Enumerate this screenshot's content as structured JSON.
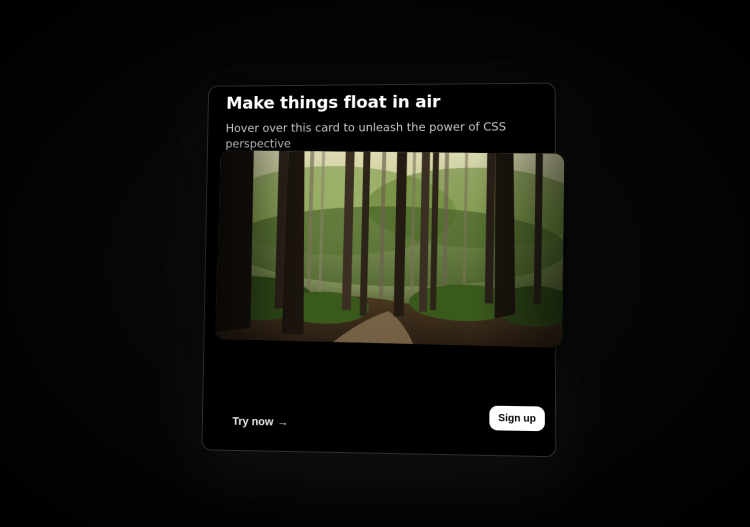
{
  "card": {
    "title": "Make things float in air",
    "subtitle": "Hover over this card to unleash the power of CSS perspective",
    "image_subject": "forest",
    "try_now_label": "Try now",
    "try_now_icon": "arrow-right-icon",
    "arrow_glyph": "→",
    "signup_label": "Sign up"
  },
  "colors": {
    "background": "#000000",
    "card_border": "#2e2e2e",
    "title": "#ffffff",
    "subtitle": "#c8c8c8",
    "button_bg": "#ffffff",
    "button_text": "#000000"
  }
}
